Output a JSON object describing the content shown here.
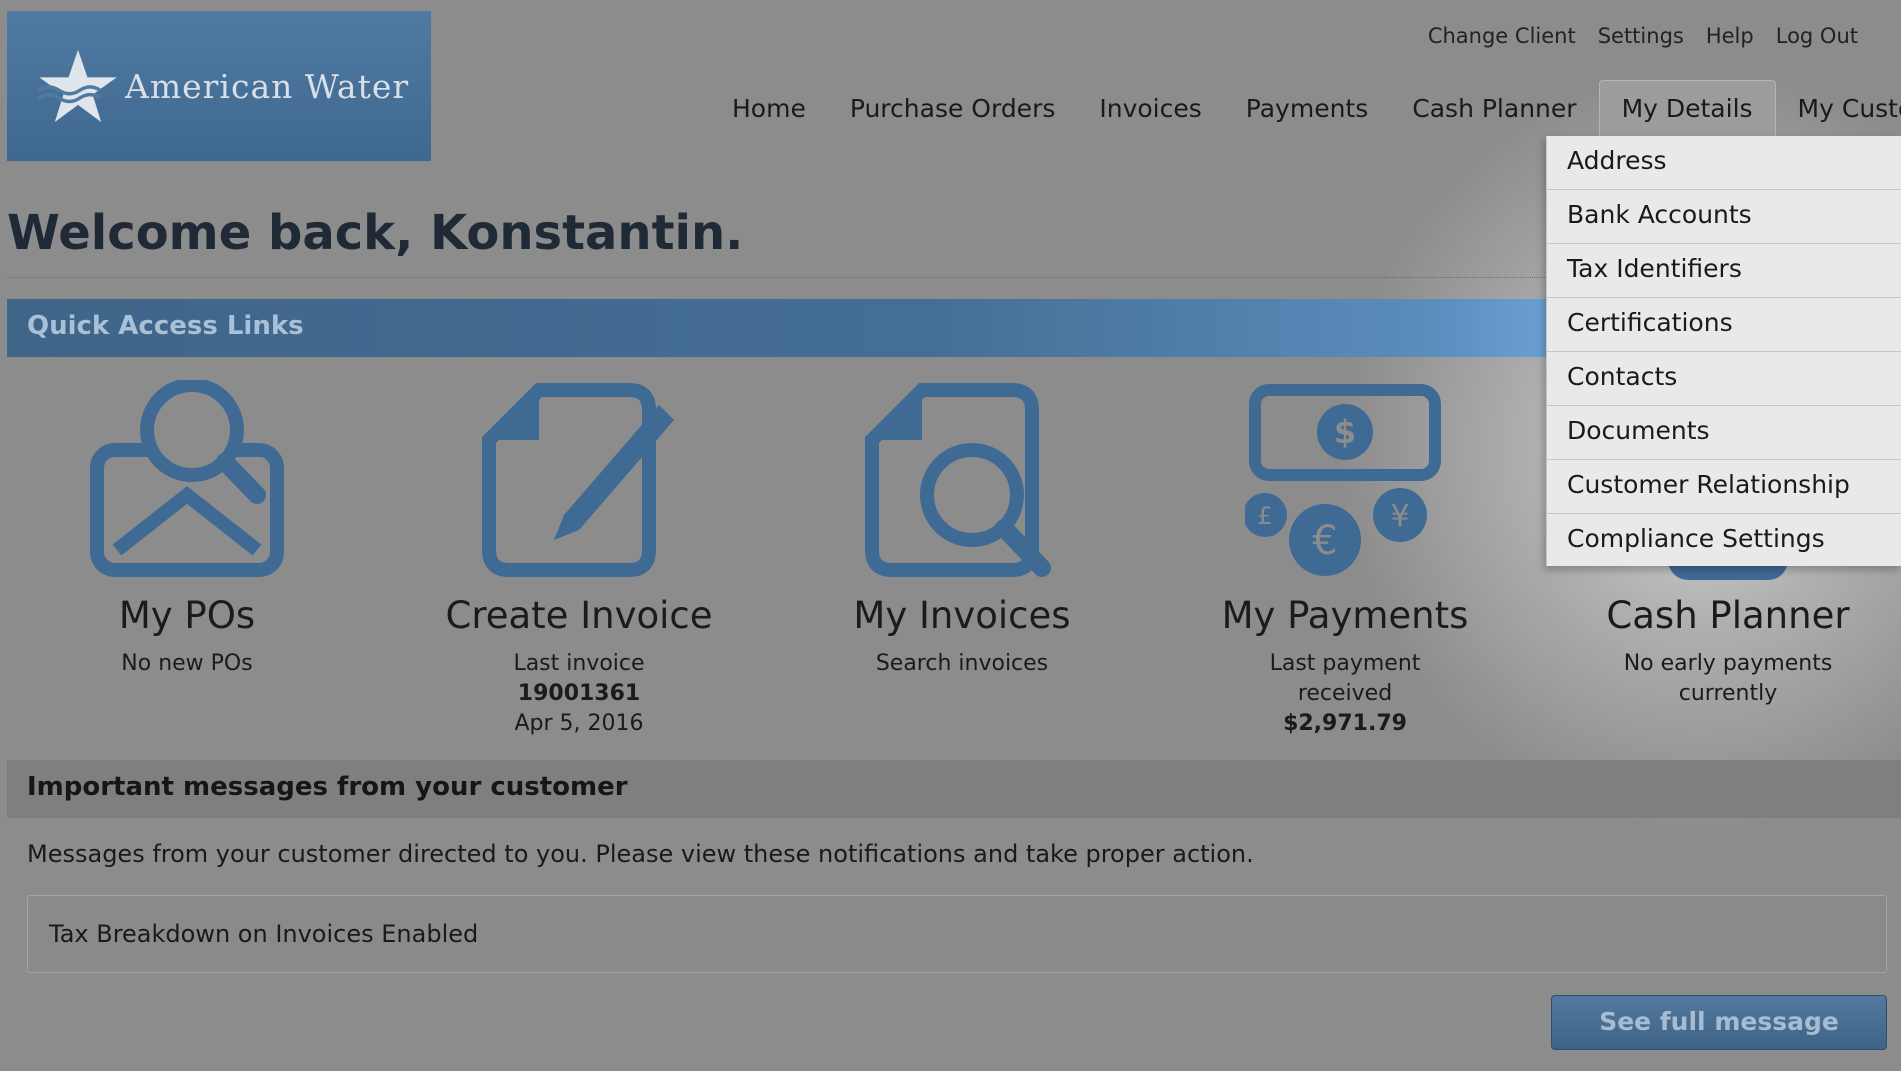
{
  "brand": {
    "name": "American Water"
  },
  "util_nav": [
    "Change Client",
    "Settings",
    "Help",
    "Log Out"
  ],
  "main_nav": [
    "Home",
    "Purchase Orders",
    "Invoices",
    "Payments",
    "Cash Planner",
    "My Details",
    "My Customer"
  ],
  "main_nav_active": "My Details",
  "welcome": "Welcome back, Konstantin.",
  "quick_access": {
    "title": "Quick Access Links"
  },
  "tiles": {
    "pos": {
      "title": "My POs",
      "sub": "No new POs"
    },
    "create_invoice": {
      "title": "Create Invoice",
      "sub1": "Last invoice",
      "sub2": "19001361",
      "sub3": "Apr 5, 2016"
    },
    "invoices": {
      "title": "My Invoices",
      "sub": "Search invoices"
    },
    "payments": {
      "title": "My Payments",
      "sub1": "Last payment",
      "sub2": "received",
      "sub3": "$2,971.79"
    },
    "cash_planner": {
      "title": "Cash Planner",
      "sub1": "No early payments",
      "sub2": "currently"
    }
  },
  "messages": {
    "header": "Important messages from your customer",
    "desc": "Messages from your customer directed to you. Please view these notifications and take proper action.",
    "item": "Tax Breakdown on Invoices Enabled",
    "button": "See full message"
  },
  "dropdown": [
    "Address",
    "Bank Accounts",
    "Tax Identifiers",
    "Certifications",
    "Contacts",
    "Documents",
    "Customer Relationship",
    "Compliance Settings"
  ],
  "colors": {
    "icon_blue": "#3f6a94",
    "header_blue": "#456e95"
  }
}
